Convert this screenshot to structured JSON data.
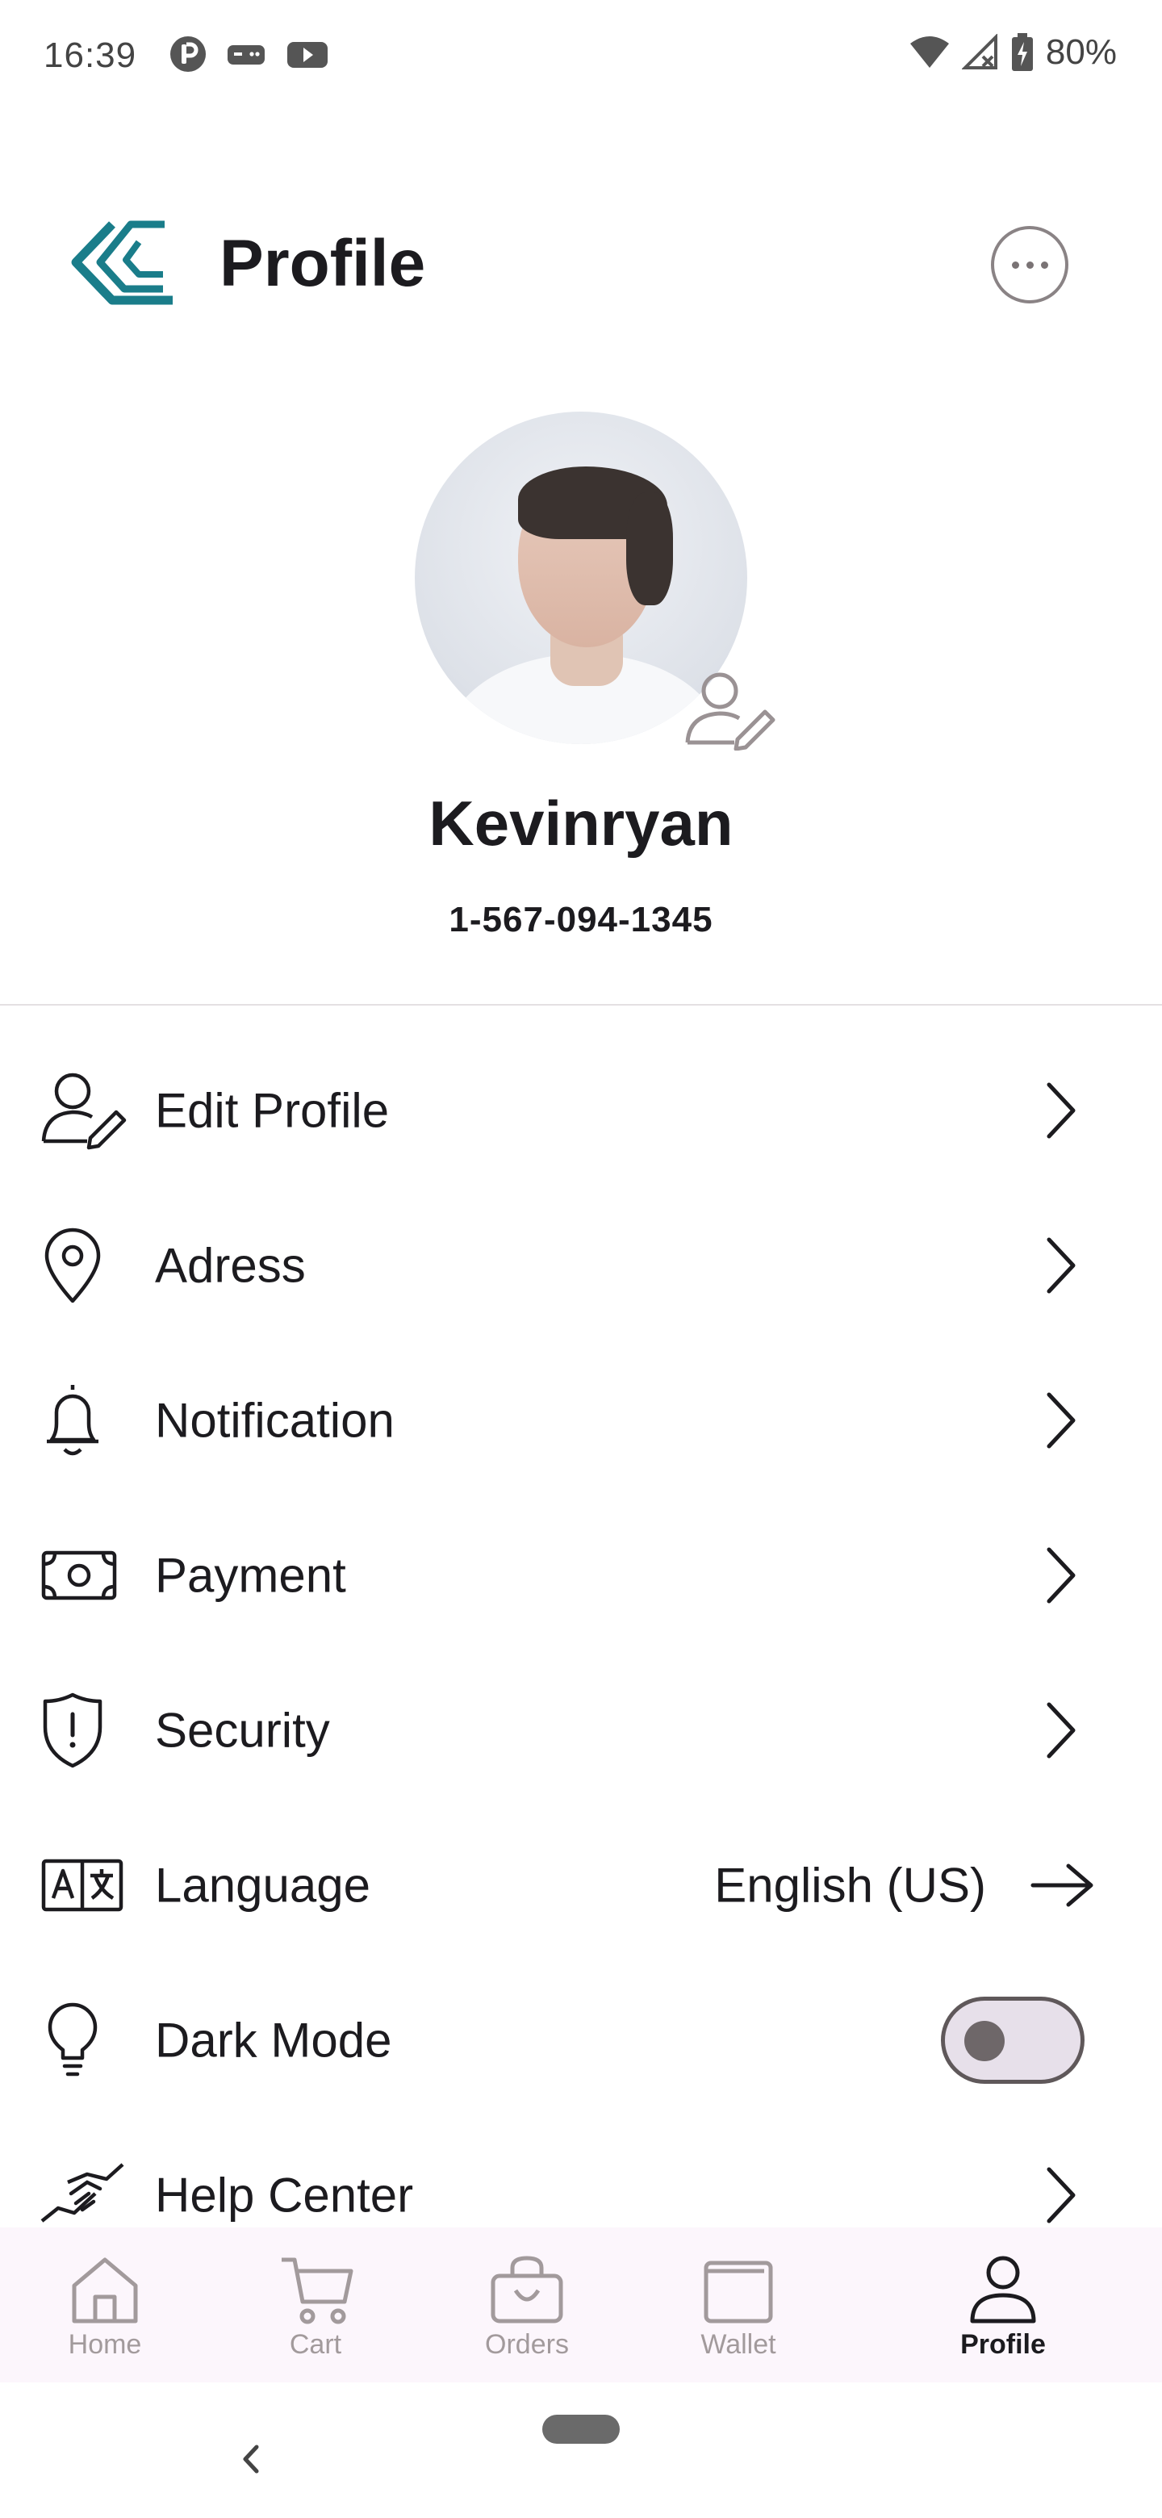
{
  "status_bar": {
    "time": "16:39",
    "battery": "80%",
    "left_icons": [
      "app-p-icon",
      "gamepad-icon",
      "youtube-icon"
    ],
    "right_icons": [
      "wifi-icon",
      "no-signal-icon",
      "battery-charging-icon"
    ]
  },
  "header": {
    "title": "Profile",
    "logo_icon": "brand-logo-icon",
    "more_icon": "more-horizontal-icon",
    "logo_color": "#1a7d8a"
  },
  "profile": {
    "name": "Kevinryan",
    "phone": "1-567-094-1345",
    "edit_avatar_icon": "user-edit-icon"
  },
  "menu": {
    "items": [
      {
        "label": "Edit Profile",
        "icon": "user-edit-icon",
        "trailing": "chevron"
      },
      {
        "label": "Adress",
        "icon": "location-pin-icon",
        "trailing": "chevron"
      },
      {
        "label": "Notification",
        "icon": "bell-icon",
        "trailing": "chevron"
      },
      {
        "label": "Payment",
        "icon": "banknote-icon",
        "trailing": "chevron"
      },
      {
        "label": "Security",
        "icon": "shield-alert-icon",
        "trailing": "chevron"
      },
      {
        "label": "Language",
        "icon": "translate-icon",
        "trailing": "arrow",
        "value": "English (US)"
      },
      {
        "label": "Dark Mode",
        "icon": "lightbulb-icon",
        "trailing": "toggle",
        "toggle_on": false
      },
      {
        "label": "Help Center",
        "icon": "handshake-icon",
        "trailing": "chevron"
      }
    ]
  },
  "bottom_nav": {
    "items": [
      {
        "label": "Home",
        "icon": "home-icon",
        "active": false
      },
      {
        "label": "Cart",
        "icon": "cart-icon",
        "active": false
      },
      {
        "label": "Orders",
        "icon": "orders-bag-icon",
        "active": false
      },
      {
        "label": "Wallet",
        "icon": "wallet-icon",
        "active": false
      },
      {
        "label": "Profile",
        "icon": "profile-icon",
        "active": true
      }
    ]
  },
  "colors": {
    "accent": "#1a7d8a",
    "text": "#1c1b1f",
    "nav_background": "#fcf6fc",
    "inactive": "#a29a9c"
  }
}
